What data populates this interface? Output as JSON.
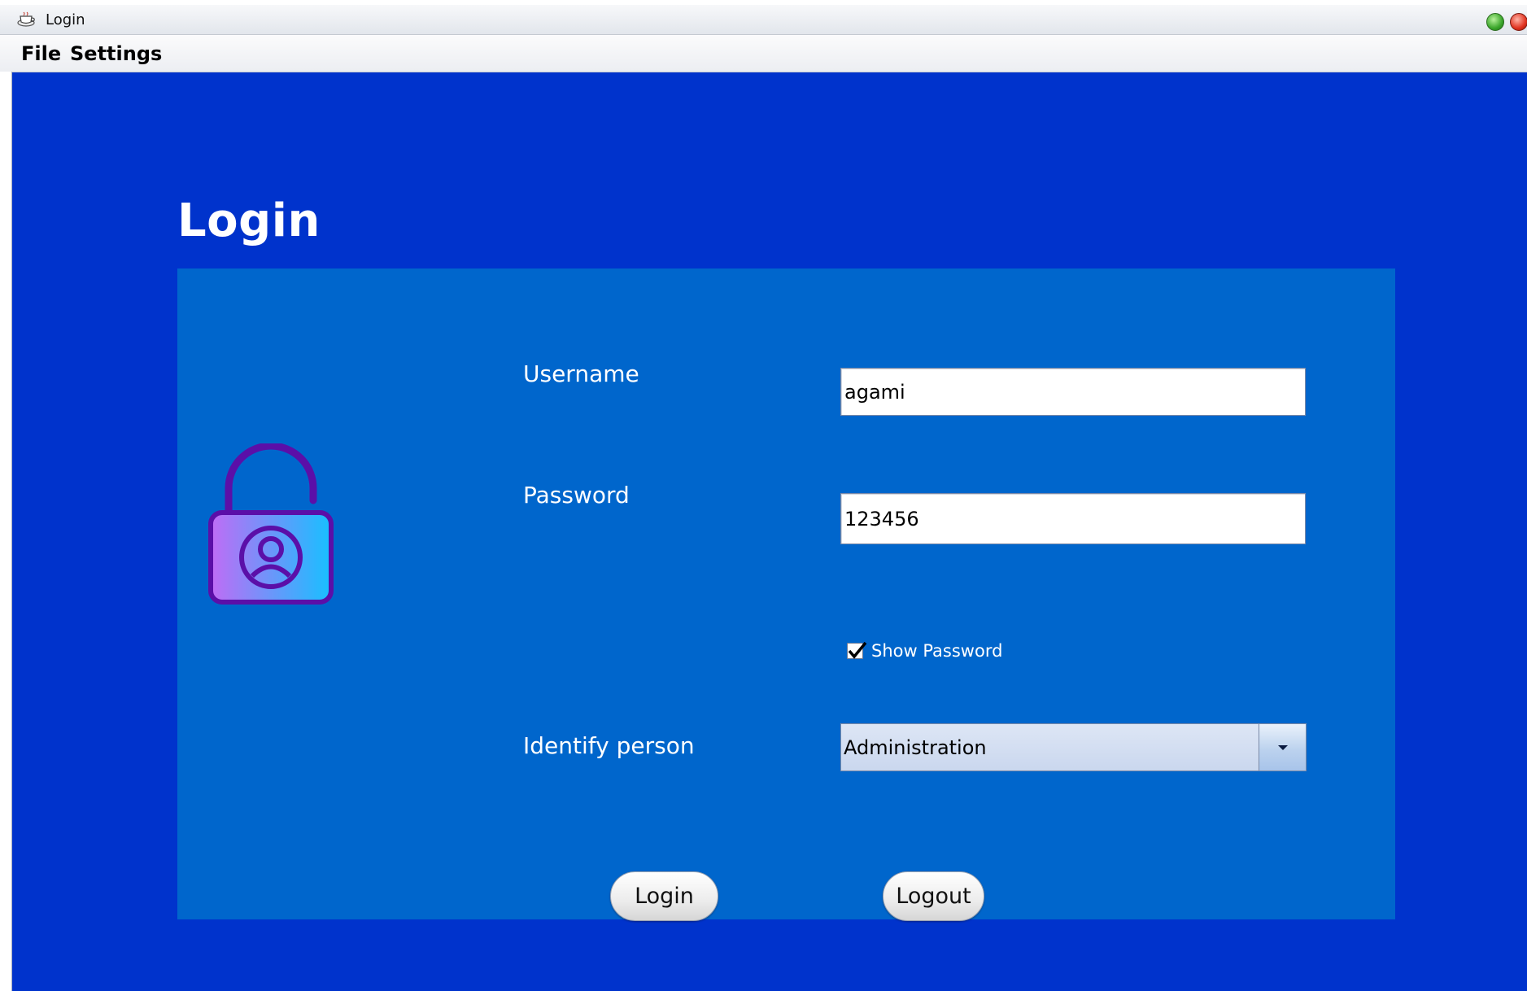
{
  "window": {
    "title": "Login"
  },
  "menubar": {
    "items": [
      {
        "label": "File"
      },
      {
        "label": "Settings"
      }
    ]
  },
  "page": {
    "title": "Login"
  },
  "form": {
    "username": {
      "label": "Username",
      "value": "agami"
    },
    "password": {
      "label": "Password",
      "value": "123456"
    },
    "show_password": {
      "label": "Show Password",
      "checked": true
    },
    "identify_person": {
      "label": "Identify person",
      "selected": "Administration"
    }
  },
  "buttons": {
    "login": "Login",
    "logout": "Logout"
  },
  "icons": {
    "app": "coffee-cup-icon",
    "lock": "unlocked-padlock-user-icon",
    "dropdown": "chevron-down-icon"
  },
  "colors": {
    "background": "#0033cc",
    "panel": "#0066cc",
    "lock_outline": "#5b0fa8",
    "lock_gradient_start": "#c06cf5",
    "lock_gradient_end": "#17c0ff"
  }
}
